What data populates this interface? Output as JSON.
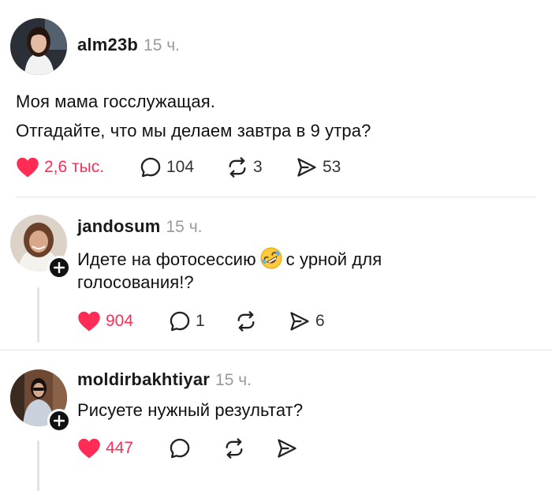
{
  "post": {
    "username": "alm23b",
    "time": "15 ч.",
    "lines": [
      "Моя мама госслужащая.",
      "Отгадайте, что мы делаем завтра в 9 утра?"
    ],
    "likes": "2,6 тыс.",
    "comments": "104",
    "reposts": "3",
    "shares": "53"
  },
  "replies": [
    {
      "username": "jandosum",
      "time": "15 ч.",
      "line1_before": "Идете на фотосессию",
      "line1_after": "с урной для",
      "line2": "голосования!?",
      "emoji": "rolling-on-floor-laughing",
      "likes": "904",
      "comments": "1",
      "reposts": "",
      "shares": "6"
    },
    {
      "username": "moldirbakhtiyar",
      "time": "15 ч.",
      "line1": "Рисуете нужный результат?",
      "likes": "447",
      "comments": "",
      "reposts": "",
      "shares": ""
    }
  ],
  "colors": {
    "like": "#ff2d55",
    "muted": "#9a9a9a",
    "divider": "#e4e4e4"
  },
  "icons": [
    "heart-icon",
    "comment-bubble-icon",
    "repost-icon",
    "send-icon",
    "plus-icon"
  ]
}
